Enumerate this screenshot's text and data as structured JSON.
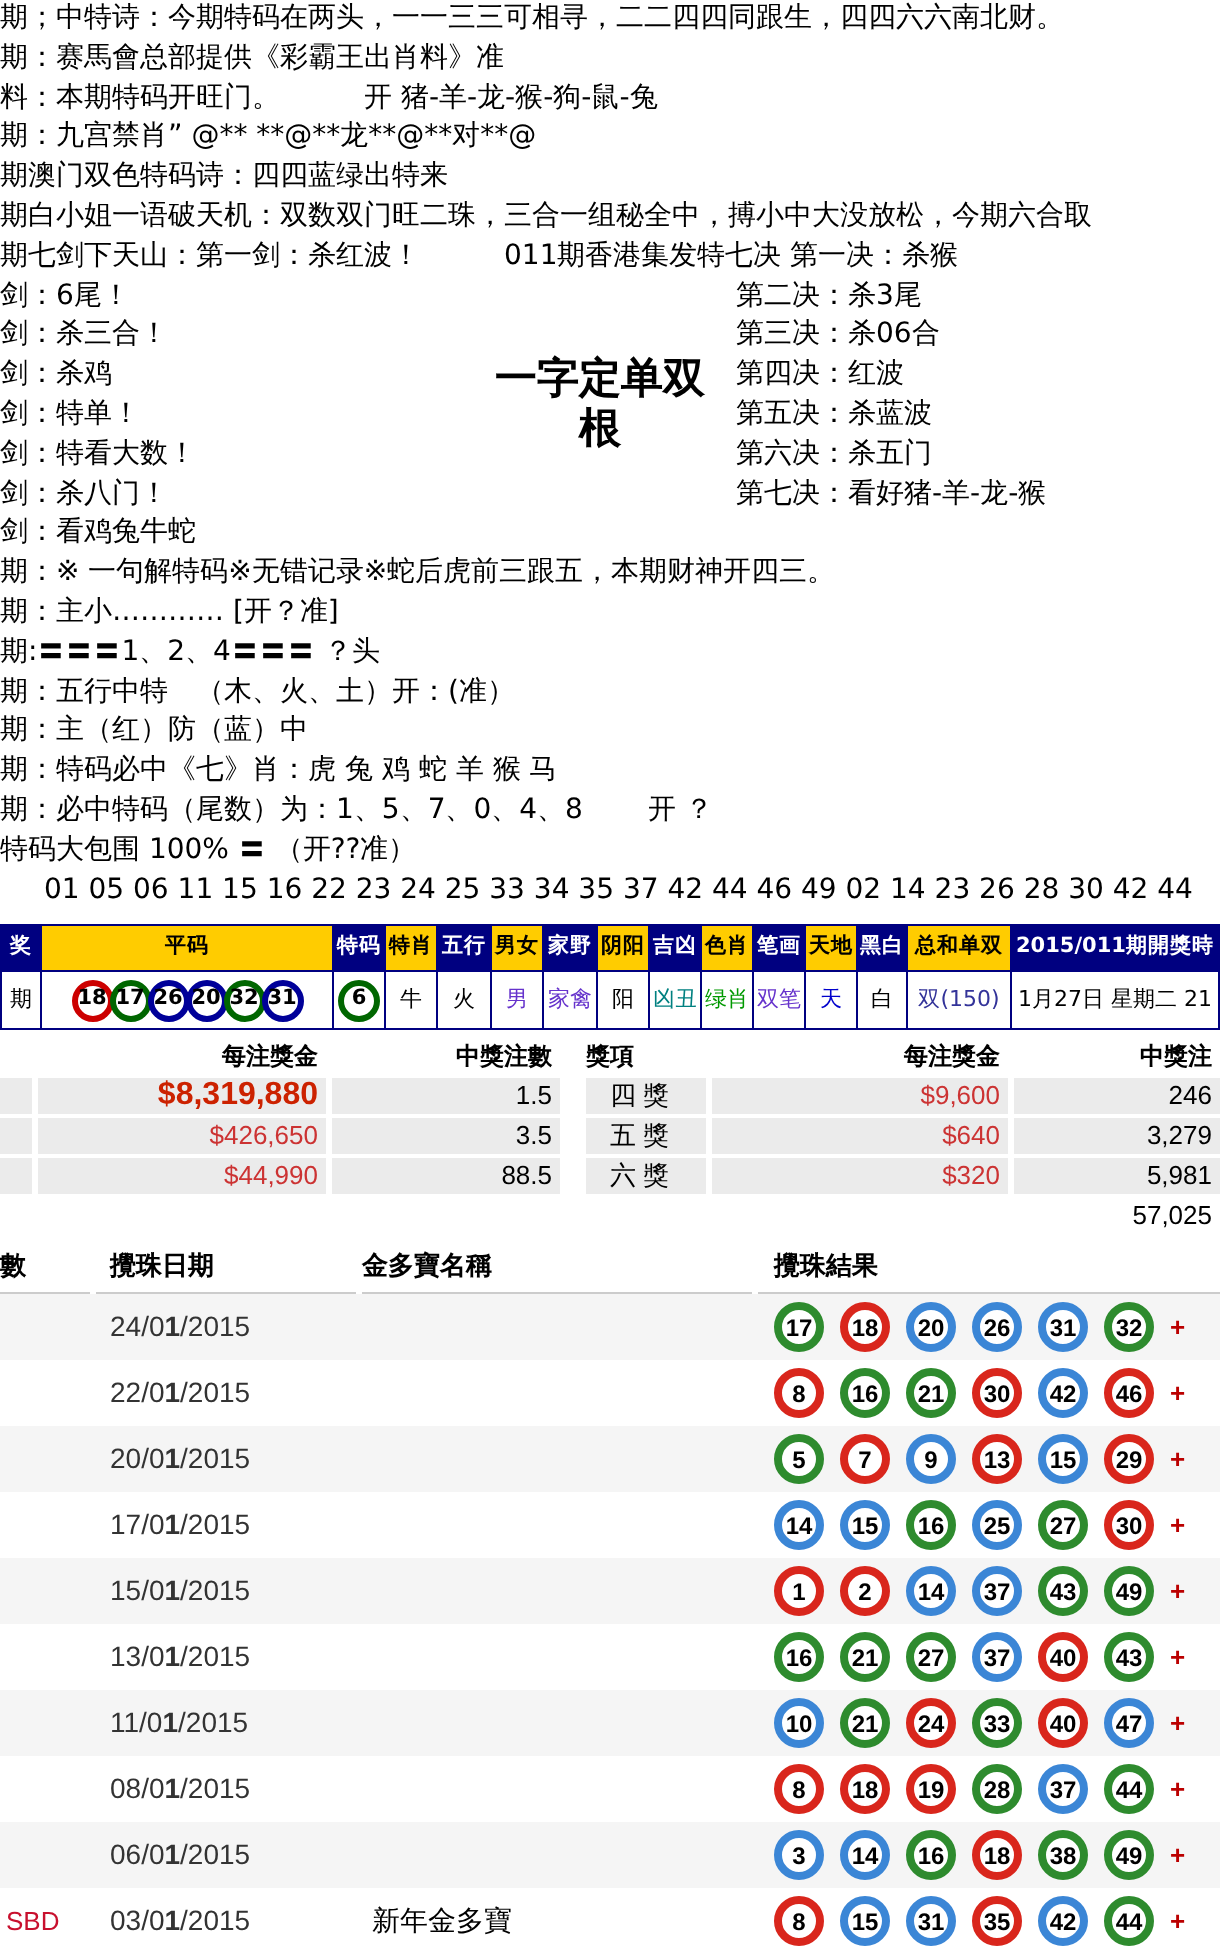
{
  "verses": [
    {
      "text": "期；中特诗：今期特码在两头，一一三三可相寻，二二四四同跟生，四四六六南北财。"
    },
    {
      "text": "期：赛馬會总部提供《彩霸王出肖料》准"
    },
    {
      "text": "料：本期特码开旺门。",
      "aside": "开 猪-羊-龙-猴-狗-鼠-兔"
    },
    {
      "text": "期：九宫禁肖” @** **@**龙**@**对**@"
    },
    {
      "text": "期澳门双色特码诗：四四蓝绿出特来"
    },
    {
      "text": "期白小姐一语破天机：双数双门旺二珠，三合一组秘全中，搏小中大没放松，今期六合取"
    },
    {
      "text": "期七剑下天山：第一剑：杀红波！",
      "aside": "011期香港集发特七决 第一决：杀猴"
    }
  ],
  "seven_swords": {
    "left": [
      "剑：6尾！",
      "剑：杀三合！",
      "剑：杀鸡",
      "剑：特单！",
      "剑：特看大数！",
      "剑：杀八门！",
      "剑：看鸡兔牛蛇"
    ],
    "title": "一字定单双根",
    "right": [
      "第二决：杀3尾",
      "第三决：杀06合",
      "第四决：红波",
      "第五决：杀蓝波",
      "第六决：杀五门",
      "第七决：看好猪-羊-龙-猴"
    ]
  },
  "tips": [
    "期：※ 一句解特码※无错记录※蛇后虎前三跟五，本期财神开四三。",
    "期：主小………… [开？准]",
    "期:〓〓〓1、2、4〓〓〓 ？头",
    "期：五行中特　（木、火、土）开：(准）",
    "期：主（红）防（蓝）中",
    "期：特码必中《七》肖：虎 兔 鸡 蛇 羊 猴 马",
    "期：必中特码（尾数）为：1、5、7、0、4、8　　 开 ？",
    "特码大包围 100% 〓 （开??准）"
  ],
  "number_pool": "01 05 06 11 15 16 22 23 24 25 33 34 35 37 42 44 46 49 02 14 23 26 28 30 42 44",
  "result_table": {
    "columns": [
      {
        "label": "奖",
        "highlight": false
      },
      {
        "label": "平码",
        "highlight": true
      },
      {
        "label": "特码",
        "highlight": false
      },
      {
        "label": "特肖",
        "highlight": true
      },
      {
        "label": "五行",
        "highlight": false
      },
      {
        "label": "男女",
        "highlight": true
      },
      {
        "label": "家野",
        "highlight": false
      },
      {
        "label": "阴阳",
        "highlight": true
      },
      {
        "label": "吉凶",
        "highlight": false
      },
      {
        "label": "色肖",
        "highlight": true
      },
      {
        "label": "笔画",
        "highlight": false
      },
      {
        "label": "天地",
        "highlight": true
      },
      {
        "label": "黑白",
        "highlight": false
      },
      {
        "label": "总和单双",
        "highlight": true
      },
      {
        "label": "2015/011期開獎時",
        "highlight": false
      }
    ],
    "row": {
      "period": "期",
      "balls": [
        {
          "n": "18",
          "color": "#cc0000"
        },
        {
          "n": "17",
          "color": "#006600"
        },
        {
          "n": "26",
          "color": "#000099"
        },
        {
          "n": "20",
          "color": "#000099"
        },
        {
          "n": "32",
          "color": "#006600"
        },
        {
          "n": "31",
          "color": "#000099"
        }
      ],
      "special": {
        "n": "6",
        "color": "#006600"
      },
      "cells": [
        {
          "text": "牛",
          "color": "#000000"
        },
        {
          "text": "火",
          "color": "#000000"
        },
        {
          "text": "男",
          "color": "#6633cc"
        },
        {
          "text": "家禽",
          "color": "#6633cc"
        },
        {
          "text": "阳",
          "color": "#000000"
        },
        {
          "text": "凶丑",
          "color": "#008080"
        },
        {
          "text": "绿肖",
          "color": "#009900"
        },
        {
          "text": "双笔",
          "color": "#6633cc"
        },
        {
          "text": "天",
          "color": "#0000cc"
        },
        {
          "text": "白",
          "color": "#000000"
        },
        {
          "text": "双(150)",
          "color": "#333399"
        },
        {
          "text": "1月27日 星期二 21",
          "color": "#000000"
        }
      ]
    }
  },
  "prizes": {
    "columns": [
      "每注獎金",
      "中獎注數",
      "獎項",
      "每注獎金",
      "中獎注"
    ],
    "rows": [
      {
        "amount": "$8,319,880",
        "featured": true,
        "winners": "1.5",
        "tier": "四 獎",
        "amount_2": "$9,600",
        "winners_2": "246"
      },
      {
        "amount": "$426,650",
        "featured": false,
        "winners": "3.5",
        "tier": "五 獎",
        "amount_2": "$640",
        "winners_2": "3,279"
      },
      {
        "amount": "$44,990",
        "featured": false,
        "winners": "88.5",
        "tier": "六 獎",
        "amount_2": "$320",
        "winners_2": "5,981"
      }
    ],
    "total": "57,025"
  },
  "draws": {
    "columns": [
      "數",
      "攪珠日期",
      "金多寶名稱",
      "攪珠結果"
    ],
    "rows": [
      {
        "date": "24/0**1**/2015",
        "balls": [
          {
            "n": "17",
            "color": "#2e8b2e"
          },
          {
            "n": "18",
            "color": "#d9261c"
          },
          {
            "n": "20",
            "color": "#3b86d6"
          },
          {
            "n": "26",
            "color": "#3b86d6"
          },
          {
            "n": "31",
            "color": "#3b86d6"
          },
          {
            "n": "32",
            "color": "#2e8b2e"
          }
        ],
        "plus": "+"
      },
      {
        "date": "22/0**1**/2015",
        "balls": [
          {
            "n": "8",
            "color": "#d9261c"
          },
          {
            "n": "16",
            "color": "#2e8b2e"
          },
          {
            "n": "21",
            "color": "#2e8b2e"
          },
          {
            "n": "30",
            "color": "#d9261c"
          },
          {
            "n": "42",
            "color": "#3b86d6"
          },
          {
            "n": "46",
            "color": "#d9261c"
          }
        ],
        "plus": "+"
      },
      {
        "date": "20/0**1**/2015",
        "balls": [
          {
            "n": "5",
            "color": "#2e8b2e"
          },
          {
            "n": "7",
            "color": "#d9261c"
          },
          {
            "n": "9",
            "color": "#3b86d6"
          },
          {
            "n": "13",
            "color": "#d9261c"
          },
          {
            "n": "15",
            "color": "#3b86d6"
          },
          {
            "n": "29",
            "color": "#d9261c"
          }
        ],
        "plus": "+"
      },
      {
        "date": "17/0**1**/2015",
        "balls": [
          {
            "n": "14",
            "color": "#3b86d6"
          },
          {
            "n": "15",
            "color": "#3b86d6"
          },
          {
            "n": "16",
            "color": "#2e8b2e"
          },
          {
            "n": "25",
            "color": "#3b86d6"
          },
          {
            "n": "27",
            "color": "#2e8b2e"
          },
          {
            "n": "30",
            "color": "#d9261c"
          }
        ],
        "plus": "+"
      },
      {
        "date": "15/0**1**/2015",
        "balls": [
          {
            "n": "1",
            "color": "#d9261c"
          },
          {
            "n": "2",
            "color": "#d9261c"
          },
          {
            "n": "14",
            "color": "#3b86d6"
          },
          {
            "n": "37",
            "color": "#3b86d6"
          },
          {
            "n": "43",
            "color": "#2e8b2e"
          },
          {
            "n": "49",
            "color": "#2e8b2e"
          }
        ],
        "plus": "+"
      },
      {
        "date": "13/0**1**/2015",
        "balls": [
          {
            "n": "16",
            "color": "#2e8b2e"
          },
          {
            "n": "21",
            "color": "#2e8b2e"
          },
          {
            "n": "27",
            "color": "#2e8b2e"
          },
          {
            "n": "37",
            "color": "#3b86d6"
          },
          {
            "n": "40",
            "color": "#d9261c"
          },
          {
            "n": "43",
            "color": "#2e8b2e"
          }
        ],
        "plus": "+"
      },
      {
        "date": "11/0**1**/2015",
        "balls": [
          {
            "n": "10",
            "color": "#3b86d6"
          },
          {
            "n": "21",
            "color": "#2e8b2e"
          },
          {
            "n": "24",
            "color": "#d9261c"
          },
          {
            "n": "33",
            "color": "#2e8b2e"
          },
          {
            "n": "40",
            "color": "#d9261c"
          },
          {
            "n": "47",
            "color": "#3b86d6"
          }
        ],
        "plus": "+"
      },
      {
        "date": "08/0**1**/2015",
        "balls": [
          {
            "n": "8",
            "color": "#d9261c"
          },
          {
            "n": "18",
            "color": "#d9261c"
          },
          {
            "n": "19",
            "color": "#d9261c"
          },
          {
            "n": "28",
            "color": "#2e8b2e"
          },
          {
            "n": "37",
            "color": "#3b86d6"
          },
          {
            "n": "44",
            "color": "#2e8b2e"
          }
        ],
        "plus": "+"
      },
      {
        "date": "06/0**1**/2015",
        "balls": [
          {
            "n": "3",
            "color": "#3b86d6"
          },
          {
            "n": "14",
            "color": "#3b86d6"
          },
          {
            "n": "16",
            "color": "#2e8b2e"
          },
          {
            "n": "18",
            "color": "#d9261c"
          },
          {
            "n": "38",
            "color": "#2e8b2e"
          },
          {
            "n": "49",
            "color": "#2e8b2e"
          }
        ],
        "plus": "+"
      },
      {
        "tag": "SBD",
        "date": "03/0**1**/2015",
        "name": "新年金多寶",
        "balls": [
          {
            "n": "8",
            "color": "#d9261c"
          },
          {
            "n": "15",
            "color": "#3b86d6"
          },
          {
            "n": "31",
            "color": "#3b86d6"
          },
          {
            "n": "35",
            "color": "#d9261c"
          },
          {
            "n": "42",
            "color": "#3b86d6"
          },
          {
            "n": "44",
            "color": "#2e8b2e"
          }
        ],
        "plus": "+"
      }
    ]
  }
}
